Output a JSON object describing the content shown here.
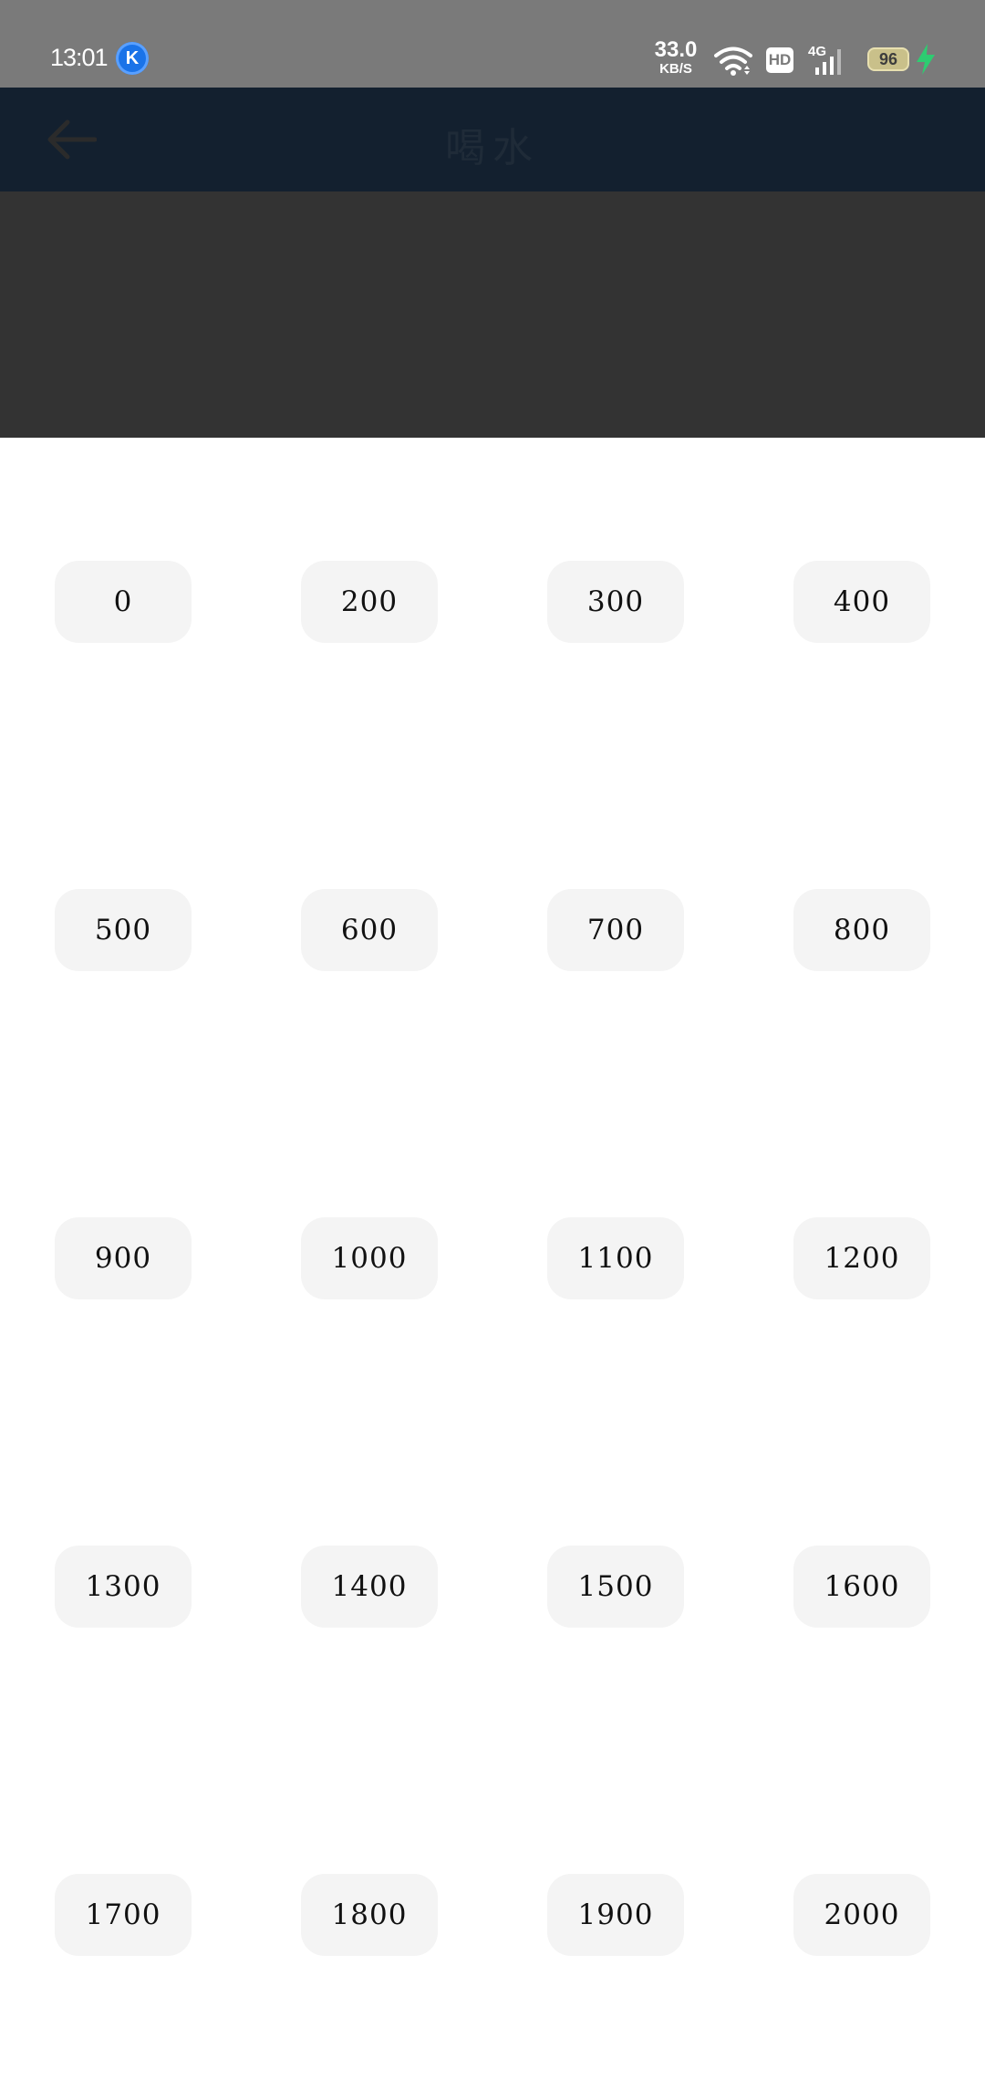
{
  "status_bar": {
    "time": "13:01",
    "app_icon_letter": "K",
    "net_speed_value": "33.0",
    "net_speed_unit": "KB/S",
    "hd_label": "HD",
    "signal_label": "4G",
    "battery_level": "96",
    "icons": [
      "k-app-icon",
      "wifi-icon",
      "hd-icon",
      "signal-icon",
      "battery-icon",
      "charging-icon"
    ],
    "charging_color": "#2ecc71"
  },
  "app_bar": {
    "title": "喝水",
    "back_icon": "back-arrow-icon",
    "background": "#13202f"
  },
  "amounts": [
    [
      "0",
      "200",
      "300",
      "400"
    ],
    [
      "500",
      "600",
      "700",
      "800"
    ],
    [
      "900",
      "1000",
      "1100",
      "1200"
    ],
    [
      "1300",
      "1400",
      "1500",
      "1600"
    ],
    [
      "1700",
      "1800",
      "1900",
      "2000"
    ]
  ]
}
